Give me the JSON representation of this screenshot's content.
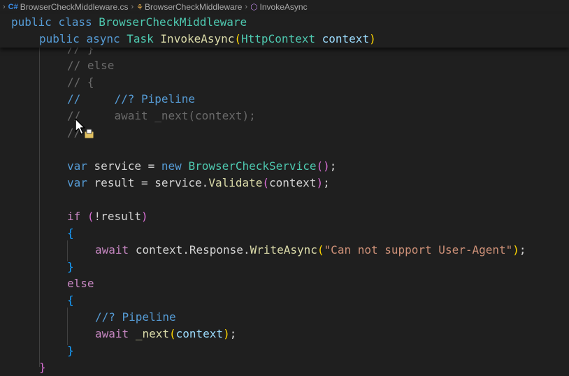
{
  "breadcrumb": {
    "file": "BrowserCheckMiddleware.cs",
    "cls": "BrowserCheckMiddleware",
    "method": "InvokeAsync"
  },
  "sticky": {
    "line1": {
      "k1": "public",
      "k2": "class",
      "name": "BrowserCheckMiddleware"
    },
    "line2": {
      "k1": "public",
      "k2": "async",
      "type": "Task",
      "fn": "InvokeAsync",
      "open": "(",
      "ptype": "HttpContext",
      "param": "context",
      "close": ")"
    }
  },
  "code": {
    "c_brace_close": "// }",
    "c_else": "// else",
    "c_brace_open": "// {",
    "c_pipeline_slash": "//",
    "c_pipeline": "//? Pipeline",
    "c_await_slash": "//",
    "c_await": "await _next(context);",
    "c_last": "//",
    "l_service": {
      "kw": "var",
      "name": "service",
      "eq": " = ",
      "new": "new",
      "type": "BrowserCheckService",
      "open": "(",
      "close": ")",
      "end": ";"
    },
    "l_result": {
      "kw": "var",
      "name": "result",
      "eq": " = ",
      "obj": "service.",
      "fn": "Validate",
      "open": "(",
      "arg": "context",
      "close": ")",
      "end": ";"
    },
    "l_if": {
      "kw": "if",
      "open": "(",
      "cond": "!result",
      "close": ")"
    },
    "l_brace1_open": "{",
    "l_write": {
      "kw": "await",
      "obj": "context.Response.",
      "fn": "WriteAsync",
      "open": "(",
      "str": "\"Can not support User-Agent\"",
      "close": ")",
      "end": ";"
    },
    "l_brace1_close": "}",
    "l_else": "else",
    "l_brace2_open": "{",
    "l_pipeline": "//? Pipeline",
    "l_next": {
      "kw": "await",
      "fn": "_next",
      "open": "(",
      "arg": "context",
      "close": ")",
      "end": ";"
    },
    "l_brace2_close": "}",
    "l_final": "}"
  },
  "colors": {
    "background": "#1f1f1f",
    "keyword": "#569cd6",
    "control": "#c586c0",
    "type": "#4ec9b0",
    "function": "#dcdcaa",
    "string": "#ce9178"
  },
  "icons": [
    "csharp-file-icon",
    "class-icon",
    "method-icon",
    "mouse-cursor-icon"
  ]
}
